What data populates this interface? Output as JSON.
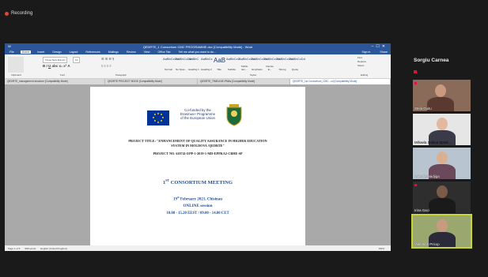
{
  "recording": {
    "label": "Recording"
  },
  "word": {
    "title": "QEDRTE_1 Consortium CMC PROGRAMME.doc [Compatibility Mode] - Word",
    "tabs": [
      "File",
      "Home",
      "Insert",
      "Design",
      "Layout",
      "References",
      "Mailings",
      "Review",
      "View",
      "Office Tab"
    ],
    "tell_me": "Tell me what you want to do...",
    "share": "Share",
    "signin": "Sign in",
    "font_name": "Times New Roman",
    "font_size": "12",
    "groups": [
      "Clipboard",
      "Font",
      "Paragraph",
      "Styles",
      "Editing"
    ],
    "styles": [
      {
        "sample": "AaBbCcDd",
        "name": "Normal"
      },
      {
        "sample": "AaBbCcDd",
        "name": "No Spac..."
      },
      {
        "sample": "AaBbC",
        "name": "Heading 1"
      },
      {
        "sample": "AaBbCc",
        "name": "Heading 2"
      },
      {
        "sample": "AaB",
        "name": "Title"
      },
      {
        "sample": "AaBbCcD",
        "name": "Subtitle"
      },
      {
        "sample": "AaBbCcDd",
        "name": "Subtle Em..."
      },
      {
        "sample": "AaBbCcDd",
        "name": "Emphasis"
      },
      {
        "sample": "AaBbCcDd",
        "name": "Intense E..."
      },
      {
        "sample": "AaBbCcDd",
        "name": "Strong"
      },
      {
        "sample": "AaBbCcDd",
        "name": "Quote"
      }
    ],
    "editing": [
      "Find",
      "Replace",
      "Select"
    ],
    "doc_tabs": [
      "QEDRTE_management structure [Compatibility Mode]",
      "QEDRTE PROJECT BOOK [Compatibility Mode]",
      "QEDRTE_TIMELINE-PMAs [Compatibility Mode]",
      "QEDRTE_1st Consortium_CMC...cd [Compatibility Mode]"
    ],
    "status": {
      "page": "Page 1 of 5",
      "words": "968 words",
      "lang": "English (United Kingdom)",
      "zoom": "100%"
    }
  },
  "document": {
    "cofund": [
      "Co-funded by the",
      "Erasmus+ Programme",
      "of the European Union"
    ],
    "project_title_line1": "PROJECT TITLE: \"ENHANCEMENT OF QUALITY ASSURANCE IN HIGHER EDUCATION",
    "project_title_line2": "SYSTEM IN MOLDOVA /QEDRTE\"",
    "project_no": "PROJECT NO. 610741-EPP-1-2019-1-MD-EPPKA2-CBHE-SP",
    "meeting_num": "1",
    "meeting_sup": "ST",
    "meeting_rest": "CONSORTIUM MEETING",
    "date_day": "19",
    "date_sup": "th",
    "date_rest": "February 2021, Chisinau",
    "session": "ONLINE session",
    "time": "10.00 - 15.20 EEST / 09.00 - 14.00 CET"
  },
  "participants": {
    "host": "Sorgiu Carnea",
    "tiles": [
      {
        "name": "Stela Guitu"
      },
      {
        "name": "Mihaela Sulima Spirid..."
      },
      {
        "name": "Valentia Nadjiga"
      },
      {
        "name": "Irina Gaci"
      },
      {
        "name": "Valentina Pricop"
      }
    ]
  }
}
